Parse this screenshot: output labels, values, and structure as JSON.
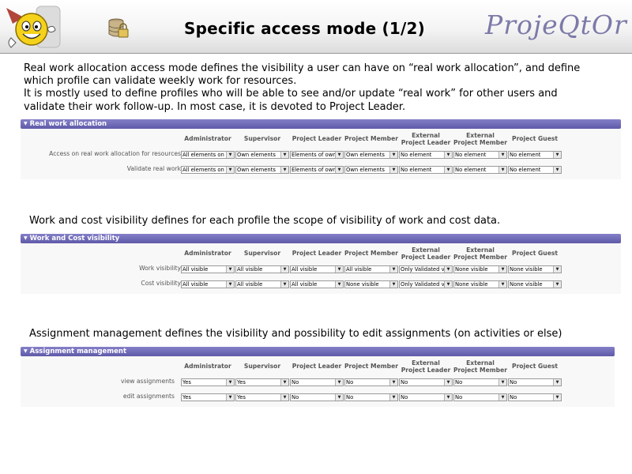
{
  "header": {
    "title": "Specific access mode (1/2)",
    "brand": "ProjeQtOr"
  },
  "intro": [
    "Real work allocation access mode defines the visibility a user can have on “real work allocation”, and define",
    "which profile can validate weekly work for resources.",
    "It is mostly used to define profiles who will be able to see and/or update “real work” for other users and",
    "validate their work follow-up. In most case, it is devoted to Project Leader."
  ],
  "columns": [
    [
      "Administrator"
    ],
    [
      "Supervisor"
    ],
    [
      "Project Leader"
    ],
    [
      "Project Member"
    ],
    [
      "External",
      "Project Leader"
    ],
    [
      "External",
      "Project Member"
    ],
    [
      "Project Guest"
    ]
  ],
  "sections": [
    {
      "title": "Real work allocation",
      "rows": [
        {
          "label": "Access on real work allocation for resources",
          "values": [
            "All elements on",
            "Own elements",
            "Elements of own",
            "Own elements",
            "No element",
            "No element",
            "No element"
          ]
        },
        {
          "label": "Validate real work",
          "values": [
            "All elements on",
            "Own elements",
            "Elements of own",
            "Own elements",
            "No element",
            "No element",
            "No element"
          ]
        }
      ]
    },
    {
      "title": "Work and Cost visibility",
      "rows": [
        {
          "label": "Work visibility",
          "values": [
            "All visible",
            "All visible",
            "All visible",
            "All visible",
            "Only Validated v",
            "None visible",
            "None visible"
          ]
        },
        {
          "label": "Cost visibility",
          "values": [
            "All visible",
            "All visible",
            "All visible",
            "None visible",
            "Only Validated v",
            "None visible",
            "None visible"
          ]
        }
      ]
    },
    {
      "title": "Assignment management",
      "rows": [
        {
          "label": "view assignments",
          "values": [
            "Yes",
            "Yes",
            "No",
            "No",
            "No",
            "No",
            "No"
          ]
        },
        {
          "label": "edit assignments",
          "values": [
            "Yes",
            "Yes",
            "No",
            "No",
            "No",
            "No",
            "No"
          ]
        }
      ]
    }
  ],
  "work_cost_text": "Work and cost visibility defines for each profile the scope of visibility of work and cost data.",
  "assignment_text": "Assignment management defines the visibility and possibility to edit assignments (on activities or else)",
  "colors": {
    "section_bar": "#6b66b4",
    "brand": "#7c7aa8"
  }
}
